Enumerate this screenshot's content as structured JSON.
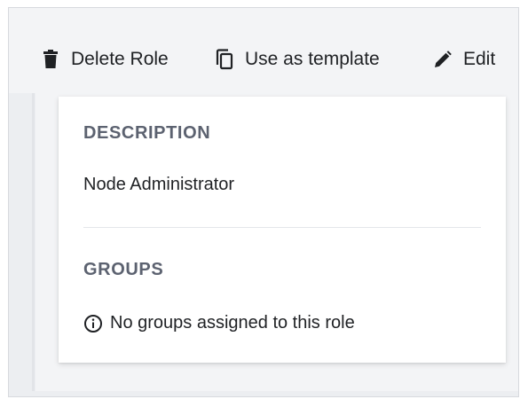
{
  "toolbar": {
    "delete_label": "Delete Role",
    "delete_icon": "trash-icon",
    "template_label": "Use as template",
    "template_icon": "copy-icon",
    "edit_label": "Edit",
    "edit_icon": "pencil-icon"
  },
  "details": {
    "description_heading": "DESCRIPTION",
    "description_value": "Node Administrator",
    "groups_heading": "GROUPS",
    "groups_empty_message": "No groups assigned to this role",
    "groups_empty_icon": "info-icon"
  },
  "colors": {
    "heading": "#5c6270",
    "text": "#1f2124",
    "background": "#f3f4f6",
    "card": "#ffffff"
  }
}
